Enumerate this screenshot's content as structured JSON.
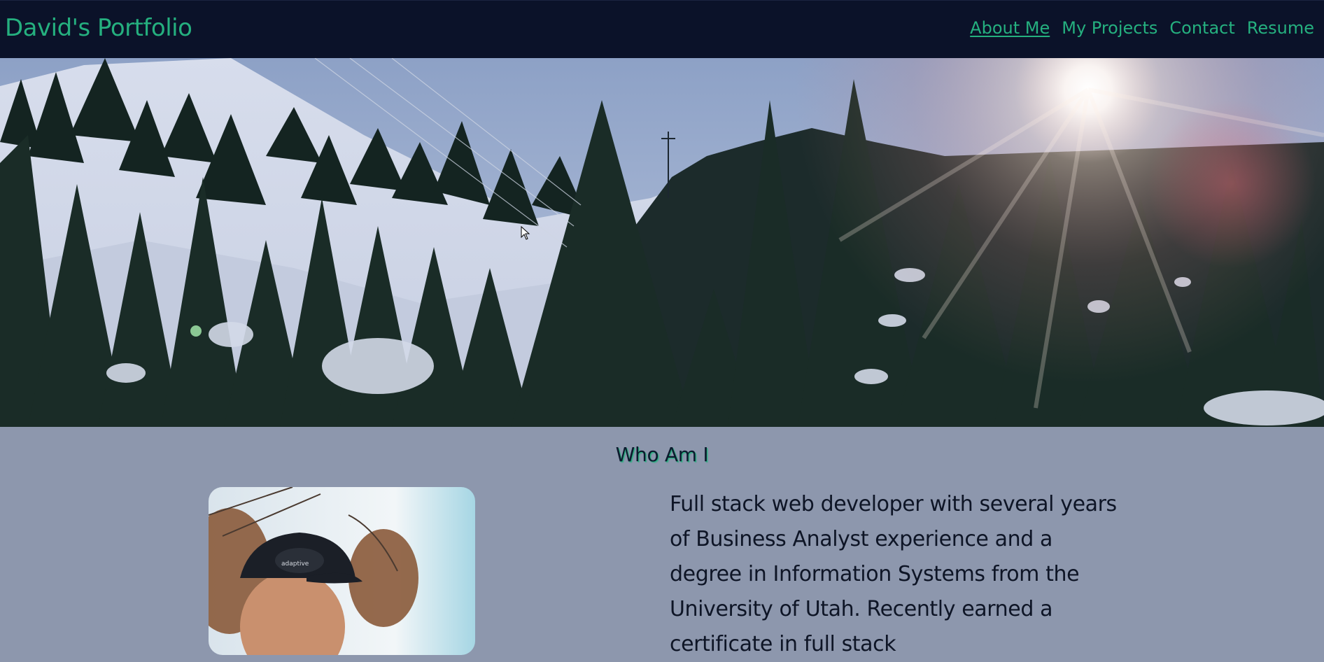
{
  "header": {
    "brand": "David's Portfolio",
    "nav": [
      {
        "label": "About Me",
        "active": true
      },
      {
        "label": "My Projects",
        "active": false
      },
      {
        "label": "Contact",
        "active": false
      },
      {
        "label": "Resume",
        "active": false
      }
    ]
  },
  "hero": {
    "image": "snowy-mountain-forest-with-sun"
  },
  "about": {
    "title": "Who Am I",
    "photo": "profile-photo",
    "paragraph": "Full stack web developer with several years of Business Analyst experience and a degree in Information Systems from the University of Utah. Recently earned a certificate in full stack"
  },
  "colors": {
    "header_bg": "#0b1229",
    "accent": "#25b07f",
    "page_bg": "#8d97ad",
    "text": "#0e1526"
  }
}
